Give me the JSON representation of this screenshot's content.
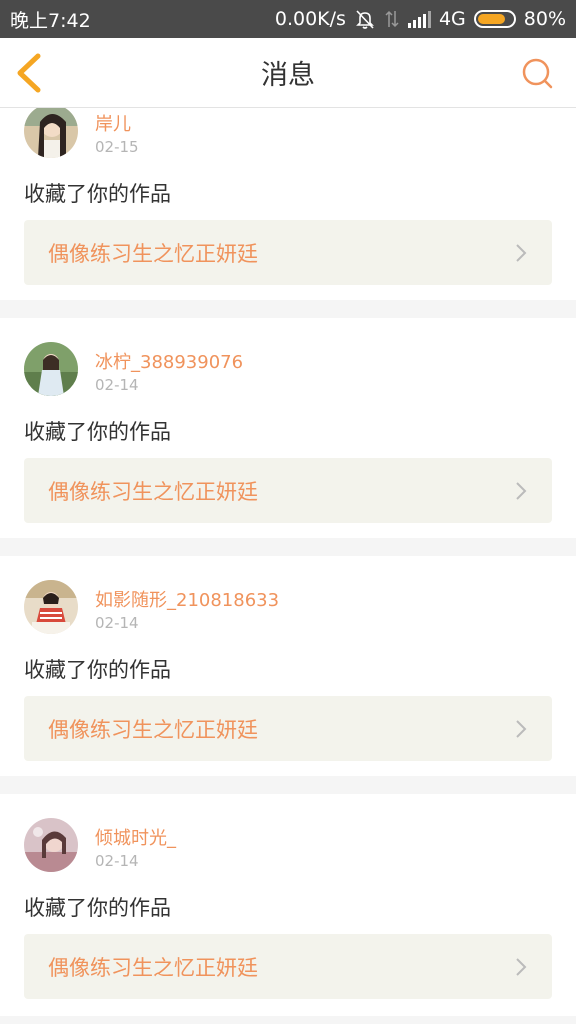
{
  "status_bar": {
    "time": "晚上7:42",
    "network_speed": "0.00K/s",
    "network_type": "4G",
    "battery": "80%"
  },
  "header": {
    "title": "消息",
    "back_icon": "back-chevron-icon",
    "search_icon": "search-icon"
  },
  "colors": {
    "accent": "#f0935c",
    "link_bg": "#f3f3ec",
    "separator": "#f5f5f5"
  },
  "messages": [
    {
      "username": "岸儿",
      "date": "02-15",
      "action": "收藏了你的作品",
      "work_title": "偶像练习生之忆正妍廷"
    },
    {
      "username": "冰柠_388939076",
      "date": "02-14",
      "action": "收藏了你的作品",
      "work_title": "偶像练习生之忆正妍廷"
    },
    {
      "username": "如影随形_210818633",
      "date": "02-14",
      "action": "收藏了你的作品",
      "work_title": "偶像练习生之忆正妍廷"
    },
    {
      "username": "倾城时光_",
      "date": "02-14",
      "action": "收藏了你的作品",
      "work_title": "偶像练习生之忆正妍廷"
    }
  ]
}
